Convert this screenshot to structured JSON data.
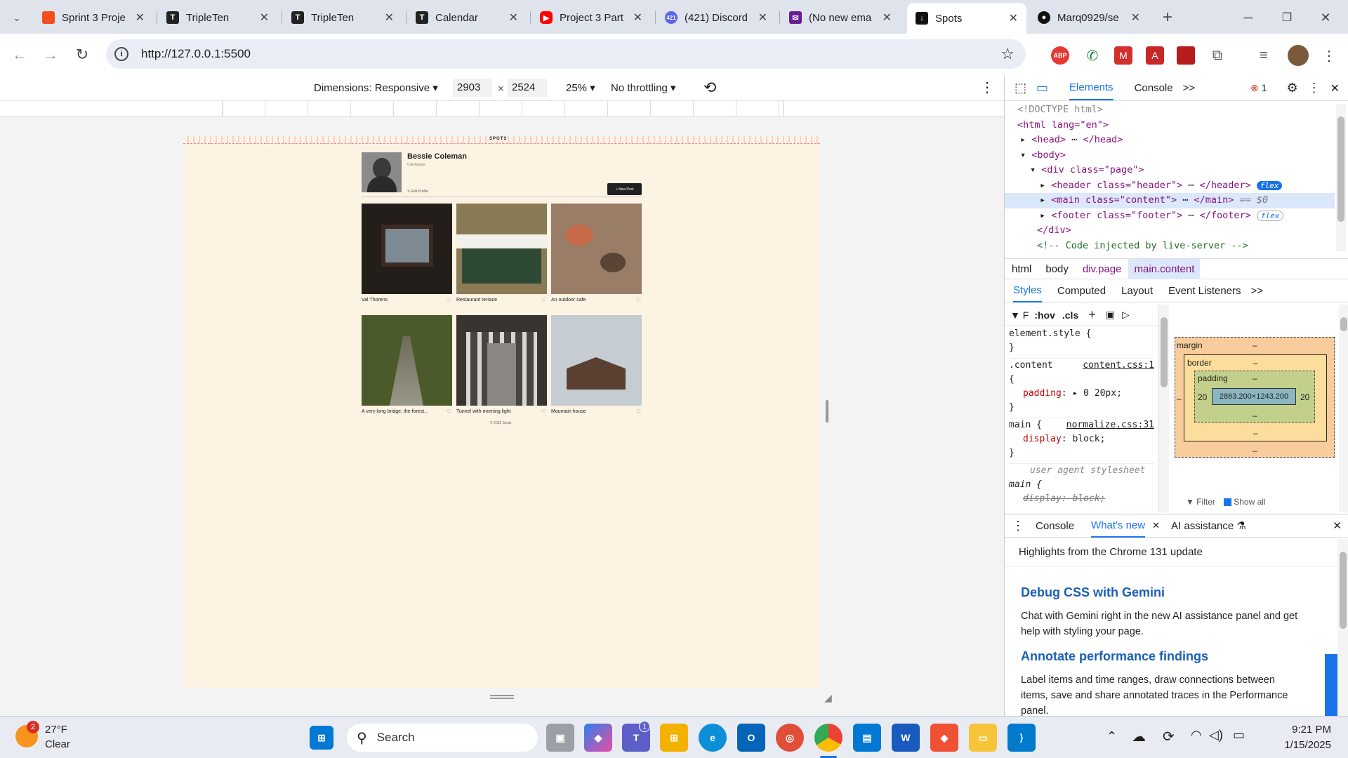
{
  "browser": {
    "tabs": [
      {
        "title": "Sprint 3 Proje",
        "icon": "figma-icon",
        "color": "#f24e1e"
      },
      {
        "title": "TripleTen",
        "icon": "tripleten-icon",
        "color": "#222222"
      },
      {
        "title": "TripleTen",
        "icon": "tripleten-icon",
        "color": "#222222"
      },
      {
        "title": "Calendar",
        "icon": "tripleten-icon",
        "color": "#222222"
      },
      {
        "title": "Project 3 Part",
        "icon": "youtube-icon",
        "color": "#ff0000"
      },
      {
        "title": "(421) Discord",
        "icon": "discord-icon",
        "color": "#5865f2",
        "badge": "421"
      },
      {
        "title": "(No new ema",
        "icon": "mail-icon",
        "color": "#6a1b9a"
      },
      {
        "title": "Spots",
        "icon": "spots-icon",
        "color": "#111111",
        "active": true
      },
      {
        "title": "Marq0929/se",
        "icon": "github-icon",
        "color": "#111111"
      }
    ],
    "new_tab": "+",
    "url": "http://127.0.0.1:5500"
  },
  "device_toolbar": {
    "dimensions_label": "Dimensions: Responsive",
    "width": "2903",
    "height": "2524",
    "times": "×",
    "zoom": "25%",
    "throttling": "No throttling"
  },
  "page": {
    "logo": "SPOTS",
    "profile_name": "Bessie Coleman",
    "profile_role": "Civil Aviator",
    "edit_profile": "Edit Profile",
    "new_post": "New Post",
    "cards": [
      {
        "caption": "Val Thorens",
        "color": "#2b2420"
      },
      {
        "caption": "Restaurant terrace",
        "color": "#6b6a4a"
      },
      {
        "caption": "An outdoor cafe",
        "color": "#8a6a55"
      },
      {
        "caption": "A very long bridge, the forest...",
        "color": "#4b5a2a"
      },
      {
        "caption": "Tunnel with morning light",
        "color": "#4a4440"
      },
      {
        "caption": "Mountain house",
        "color": "#b9c2c8"
      }
    ],
    "footer": "© 2022 Spots"
  },
  "devtools": {
    "tabs": [
      "Elements",
      "Console"
    ],
    "more": ">>",
    "error_count": "1",
    "dom": {
      "doctype": "<!DOCTYPE html>",
      "html_open": "<html lang=\"en\">",
      "head": "<head>",
      "head_close": "</head>",
      "body": "<body>",
      "div": "<div class=\"page\">",
      "header": "<header class=\"header\">",
      "header_close": "</header>",
      "main": "<main class=\"content\">",
      "main_close": "</main>",
      "main_suffix": "== $0",
      "footer": "<footer class=\"footer\">",
      "footer_close": "</footer>",
      "div_close": "</div>",
      "comment": "<!-- Code injected by live-server -->",
      "badge_flex": "flex"
    },
    "breadcrumbs": [
      "html",
      "body",
      "div.page",
      "main.content"
    ],
    "style_tabs": [
      "Styles",
      "Computed",
      "Layout",
      "Event Listeners"
    ],
    "filter_placeholder": "F",
    "hov": ":hov",
    "cls": ".cls",
    "styles": {
      "element_style": "element.style {",
      "close": "}",
      "content_selector": ".content",
      "content_src": "content.css:1",
      "open": "{",
      "padding_prop": "padding",
      "padding_val": "0 20px;",
      "main_selector": "main {",
      "main_src": "normalize.css:31",
      "display_prop": "display",
      "display_val": "block;",
      "ua_label": "user agent stylesheet",
      "ua_main": "main {",
      "ua_display": "display: block;"
    },
    "boxmodel": {
      "margin": "margin",
      "border": "border",
      "padding": "padding",
      "dash": "–",
      "pad_left": "20",
      "pad_right": "20",
      "content": "2863.200×1243.200",
      "filter": "Filter",
      "show_all": "Show all"
    },
    "drawer": {
      "tabs": [
        "Console",
        "What's new",
        "AI assistance"
      ],
      "headline": "Highlights from the Chrome 131 update",
      "items": [
        {
          "title": "Debug CSS with Gemini",
          "body": "Chat with Gemini right in the new AI assistance panel and get help with styling your page."
        },
        {
          "title": "Annotate performance findings",
          "body": "Label items and time ranges, draw connections between items, save and share annotated traces in the Performance panel."
        }
      ]
    }
  },
  "taskbar": {
    "weather_temp": "27°F",
    "weather_cond": "Clear",
    "weather_badge": "2",
    "search": "Search",
    "teams_badge": "1",
    "time": "9:21 PM",
    "date": "1/15/2025"
  }
}
